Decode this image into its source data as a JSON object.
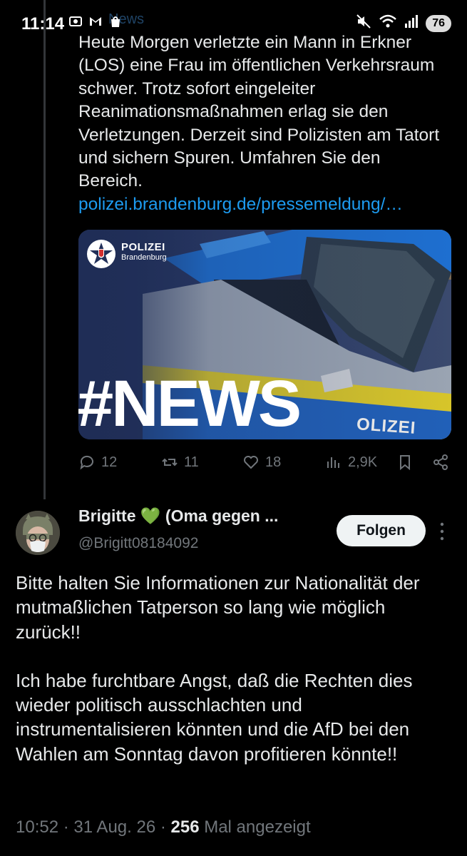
{
  "status_bar": {
    "time": "11:14",
    "ghost_text": "News",
    "battery": "76"
  },
  "tweet": {
    "text": "Heute Morgen verletzte ein Mann in Erkner (LOS) eine Frau im öffentlichen Verkehrsraum schwer. Trotz sofort eingeleiter Reanimationsmaßnahmen erlag sie den Verletzungen. Derzeit sind Polizisten am Tatort und sichern Spuren. Umfahren Sie den Bereich.",
    "link": "polizei.brandenburg.de/pressemeldung/…",
    "card": {
      "brand_line1": "POLIZEI",
      "brand_line2": "Brandenburg",
      "hashtag": "#NEWS",
      "car_text": "OLIZEI"
    },
    "actions": {
      "replies": "12",
      "retweets": "11",
      "likes": "18",
      "views": "2,9K"
    }
  },
  "reply": {
    "name": "Brigitte",
    "name_suffix": "(Oma gegen ...",
    "heart_emoji": "💚",
    "handle": "@Brigitt08184092",
    "follow_label": "Folgen",
    "para1": "Bitte halten Sie Informationen zur Nationalität der mutmaßlichen Tatperson so lang wie möglich zurück!!",
    "para2": "Ich habe furchtbare Angst, daß die Rechten dies wieder politisch ausschlachten und instrumentalisieren könnten und die AfD bei den Wahlen am Sonntag davon profitieren könnte!!",
    "meta_time": "10:52",
    "meta_date": "31 Aug. 26",
    "meta_views": "256",
    "meta_views_label": "Mal angezeigt"
  },
  "colors": {
    "background": "#000000",
    "text": "#e7e9ea",
    "muted": "#71767b",
    "link": "#1d9bf0",
    "heart": "#00c853"
  }
}
